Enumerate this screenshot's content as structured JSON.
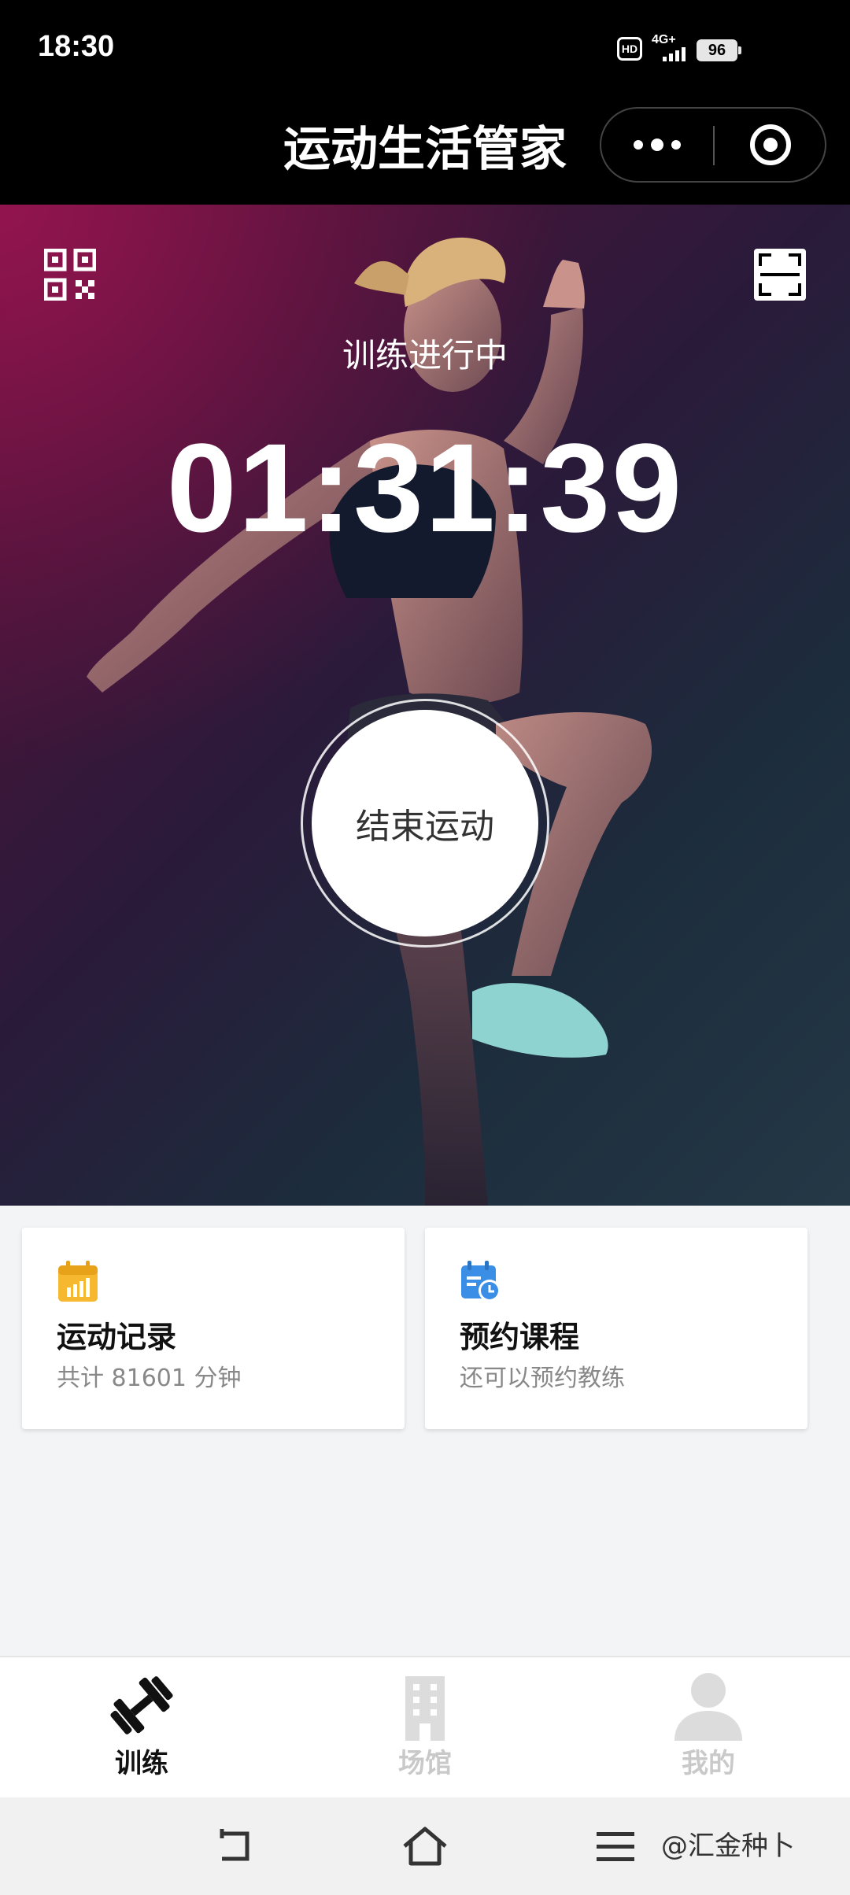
{
  "status_bar": {
    "time": "18:30",
    "hd": "HD",
    "network": "4G+",
    "battery": "96"
  },
  "header": {
    "title": "运动生活管家"
  },
  "hero": {
    "status": "训练进行中",
    "timer": "01:31:39",
    "end_button": "结束运动"
  },
  "cards": {
    "records": {
      "title": "运动记录",
      "subtitle": "共计 81601 分钟",
      "icon": "calendar-chart-icon",
      "icon_color": "#f5b82e"
    },
    "booking": {
      "title": "预约课程",
      "subtitle": "还可以预约教练",
      "icon": "calendar-clock-icon",
      "icon_color": "#3a8ee6"
    }
  },
  "tabs": [
    {
      "label": "训练",
      "icon": "dumbbell-icon",
      "active": true
    },
    {
      "label": "场馆",
      "icon": "building-icon",
      "active": false
    },
    {
      "label": "我的",
      "icon": "person-icon",
      "active": false
    }
  ],
  "system_nav": {
    "watermark": "@汇金种卜"
  },
  "colors": {
    "header_bg": "#000000",
    "tab_active": "#111111",
    "tab_inactive": "#c9c9c9"
  }
}
